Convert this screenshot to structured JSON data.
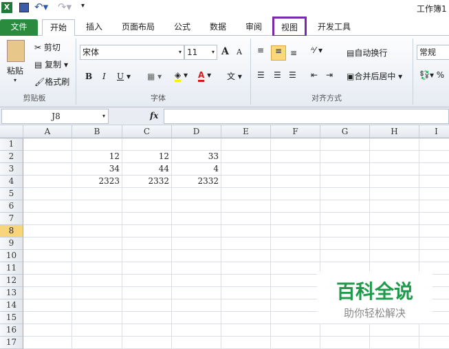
{
  "app": {
    "title": "工作簿1",
    "accent": "#1e7a3a"
  },
  "tabs": [
    {
      "label": "文件"
    },
    {
      "label": "开始"
    },
    {
      "label": "插入"
    },
    {
      "label": "页面布局"
    },
    {
      "label": "公式"
    },
    {
      "label": "数据"
    },
    {
      "label": "审阅"
    },
    {
      "label": "视图"
    },
    {
      "label": "开发工具"
    }
  ],
  "highlight_color": "#7a2aa8",
  "clipboard": {
    "paste": "粘贴",
    "cut": "剪切",
    "copy": "复制",
    "format_painter": "格式刷",
    "group": "剪贴板"
  },
  "font": {
    "name": "宋体",
    "size": "11",
    "bold": "B",
    "italic": "I",
    "underline": "U",
    "grow": "A",
    "shrink": "A",
    "phonetic": "文",
    "group": "字体"
  },
  "alignment": {
    "wrap": "自动换行",
    "merge": "合并后居中",
    "group": "对齐方式"
  },
  "number": {
    "format": "常规",
    "percent": "%"
  },
  "formula_bar": {
    "name_box": "J8",
    "fx": "fx",
    "value": ""
  },
  "columns": [
    "A",
    "B",
    "C",
    "D",
    "E",
    "F",
    "G",
    "H",
    "I"
  ],
  "rows": [
    "1",
    "2",
    "3",
    "4",
    "5",
    "6",
    "7",
    "8",
    "9",
    "10",
    "11",
    "12",
    "13",
    "14",
    "15",
    "16",
    "17"
  ],
  "selected_row": "8",
  "cells": [
    {
      "row": 2,
      "col": "B",
      "v": "12"
    },
    {
      "row": 2,
      "col": "C",
      "v": "12"
    },
    {
      "row": 2,
      "col": "D",
      "v": "33"
    },
    {
      "row": 3,
      "col": "B",
      "v": "34"
    },
    {
      "row": 3,
      "col": "C",
      "v": "44"
    },
    {
      "row": 3,
      "col": "D",
      "v": "4"
    },
    {
      "row": 4,
      "col": "B",
      "v": "2323"
    },
    {
      "row": 4,
      "col": "C",
      "v": "2332"
    },
    {
      "row": 4,
      "col": "D",
      "v": "2332"
    }
  ],
  "watermark": {
    "title": "百科全说",
    "subtitle": "助你轻松解决"
  }
}
